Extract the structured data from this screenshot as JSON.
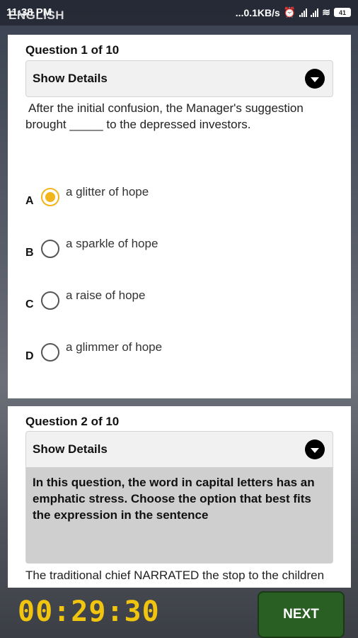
{
  "status_bar": {
    "app_title": "ENGLISH",
    "time": "11:38 PM",
    "net_speed": "...0.1KB/s",
    "battery": "41"
  },
  "question1": {
    "label": "Question 1 of 10",
    "details_label": "Show Details",
    "text": "After the initial confusion, the Manager's suggestion brought _____ to the depressed investors.",
    "options": [
      {
        "letter": "A",
        "text": "a glitter of hope",
        "selected": true
      },
      {
        "letter": "B",
        "text": "a sparkle of hope",
        "selected": false
      },
      {
        "letter": "C",
        "text": "a raise of hope",
        "selected": false
      },
      {
        "letter": "D",
        "text": "a glimmer of hope",
        "selected": false
      }
    ]
  },
  "question2": {
    "label": "Question 2 of 10",
    "details_label": "Show Details",
    "details_text": "In this question, the word in capital letters has an emphatic stress. Choose the option that best fits the expression in the sentence",
    "text": "The traditional chief NARRATED the stop to the children"
  },
  "footer": {
    "timer": "00:29:30",
    "next_label": "NEXT"
  },
  "colors": {
    "selected_radio": "#f2b51b",
    "timer": "#f1c40f",
    "next_button": "#2a5f24"
  }
}
